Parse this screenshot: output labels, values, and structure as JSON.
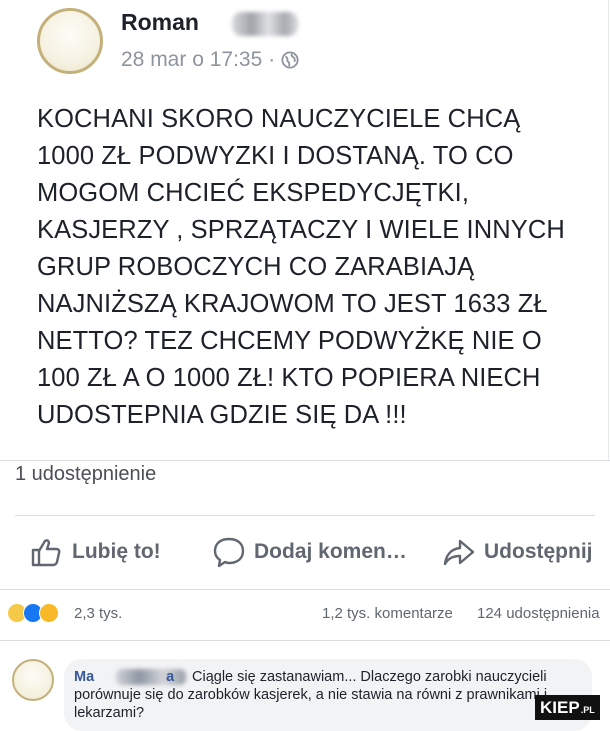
{
  "post": {
    "author": "Roman",
    "timestamp": "28 mar o 17:35",
    "visibility_separator": "·",
    "visibility_icon": "globe-icon",
    "text": "KOCHANI SKORO NAUCZYCIELE CHCĄ\n1000 ZŁ PODWYZKI I DOSTANĄ.  TO CO\nMOGOM CHCIEĆ EKSPEDYCJĘTKI,\nKASJERZY , SPRZĄTACZY I WIELE INNYCH\nGRUP  ROBOCZYCH CO ZARABIAJĄ\nNAJNIŻSZĄ KRAJOWOM TO JEST 1633 ZŁ\nNETTO? TEZ CHCEMY PODWYŻKĘ  NIE O\n100 ZŁ  A O 1000 ZŁ!  KTO POPIERA NIECH\nUDOSTEPNIA GDZIE SIĘ  DA !!!",
    "shares_line": "1 udostępnienie"
  },
  "actions": {
    "like_label": "Lubię to!",
    "comment_label": "Dodaj komen…",
    "share_label": "Udostępnij"
  },
  "stats": {
    "reactions": "2,3 tys.",
    "comments": "1,2 tys. komentarze",
    "shares": "124 udostępnienia"
  },
  "comment": {
    "author_visible": "Ma",
    "author_tail": "a",
    "text": "Ciągle się zastanawiam... Dlaczego zarobki nauczycieli porównuje się do zarobków kasjerek, a nie stawia na równi z prawnikami i lekarzami?"
  },
  "watermark": {
    "main": "KIEP",
    "suffix": ".PL"
  },
  "colors": {
    "text": "#1d2129",
    "muted": "#606770",
    "link": "#385898",
    "comment_bg": "#f2f3f5"
  }
}
